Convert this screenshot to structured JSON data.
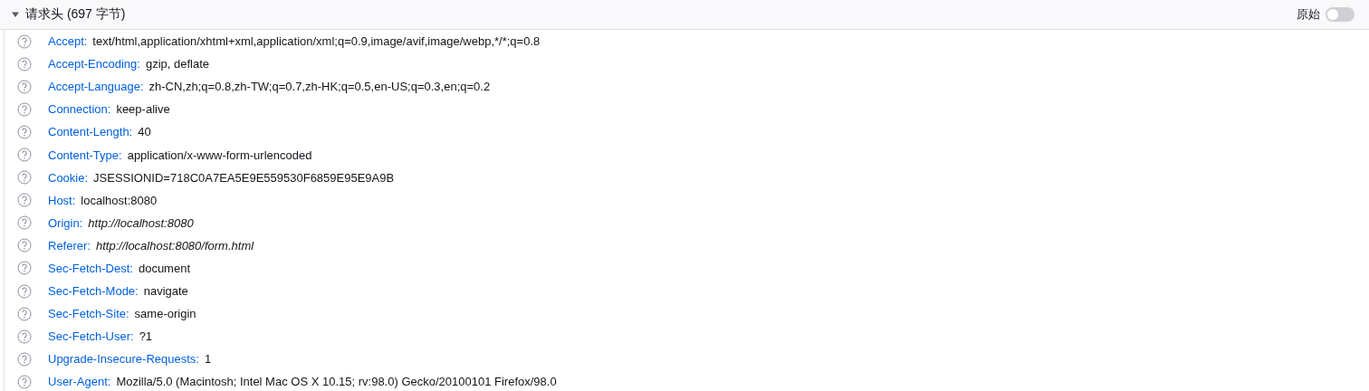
{
  "section": {
    "title": "请求头 (697 字节)",
    "expanded": true,
    "raw_toggle": {
      "label": "原始",
      "on": false
    }
  },
  "headers": [
    {
      "name": "Accept:",
      "value": "text/html,application/xhtml+xml,application/xml;q=0.9,image/avif,image/webp,*/*;q=0.8",
      "italic": false
    },
    {
      "name": "Accept-Encoding:",
      "value": "gzip, deflate",
      "italic": false
    },
    {
      "name": "Accept-Language:",
      "value": "zh-CN,zh;q=0.8,zh-TW;q=0.7,zh-HK;q=0.5,en-US;q=0.3,en;q=0.2",
      "italic": false
    },
    {
      "name": "Connection:",
      "value": "keep-alive",
      "italic": false
    },
    {
      "name": "Content-Length:",
      "value": "40",
      "italic": false
    },
    {
      "name": "Content-Type:",
      "value": "application/x-www-form-urlencoded",
      "italic": false
    },
    {
      "name": "Cookie:",
      "value": "JSESSIONID=718C0A7EA5E9E559530F6859E95E9A9B",
      "italic": false
    },
    {
      "name": "Host:",
      "value": "localhost:8080",
      "italic": false
    },
    {
      "name": "Origin:",
      "value": "http://localhost:8080",
      "italic": true
    },
    {
      "name": "Referer:",
      "value": "http://localhost:8080/form.html",
      "italic": true
    },
    {
      "name": "Sec-Fetch-Dest:",
      "value": "document",
      "italic": false
    },
    {
      "name": "Sec-Fetch-Mode:",
      "value": "navigate",
      "italic": false
    },
    {
      "name": "Sec-Fetch-Site:",
      "value": "same-origin",
      "italic": false
    },
    {
      "name": "Sec-Fetch-User:",
      "value": "?1",
      "italic": false
    },
    {
      "name": "Upgrade-Insecure-Requests:",
      "value": "1",
      "italic": false
    },
    {
      "name": "User-Agent:",
      "value": "Mozilla/5.0 (Macintosh; Intel Mac OS X 10.15; rv:98.0) Gecko/20100101 Firefox/98.0",
      "italic": false
    }
  ]
}
